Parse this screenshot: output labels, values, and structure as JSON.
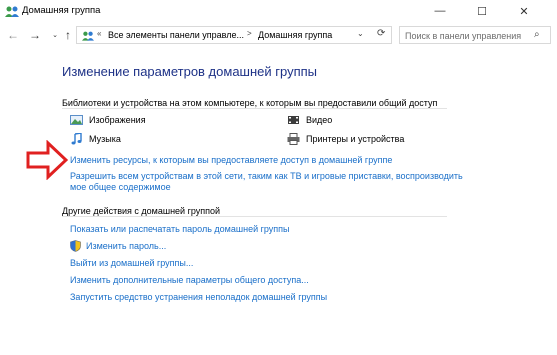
{
  "window": {
    "title": "Домашняя группа",
    "minimize": "—",
    "maximize": "☐",
    "close": "✕"
  },
  "nav": {
    "back": "←",
    "forward": "→",
    "recent": "⌄",
    "up": "↑"
  },
  "address": {
    "sep1": "«",
    "crumb1": "Все элементы панели управле...",
    "sep2": ">",
    "crumb2": "Домашняя группа",
    "dropdown": "⌄",
    "refresh": "⟳"
  },
  "search": {
    "placeholder": "Поиск в панели управления",
    "icon": "⌕"
  },
  "main": {
    "title": "Изменение параметров домашней группы",
    "libraries_heading": "Библиотеки и устройства на этом компьютере, к которым вы предоставили общий доступ",
    "libraries": {
      "images": "Изображения",
      "video": "Видео",
      "music": "Музыка",
      "printers": "Принтеры и устройства"
    },
    "change_resources_link": "Изменить ресурсы, к которым вы предоставляете доступ в домашней группе",
    "allow_devices_link": "Разрешить всем устройствам в этой сети, таким как ТВ и игровые приставки, воспроизводить мое общее содержимое",
    "other_actions_heading": "Другие действия с домашней группой",
    "actions": [
      "Показать или распечатать пароль домашней группы",
      "Изменить пароль...",
      "Выйти из домашней группы...",
      "Изменить дополнительные параметры общего доступа...",
      "Запустить средство устранения неполадок домашней группы"
    ]
  },
  "colors": {
    "link": "#1a6fc9",
    "title": "#1e3287",
    "arrow": "#e02020"
  }
}
